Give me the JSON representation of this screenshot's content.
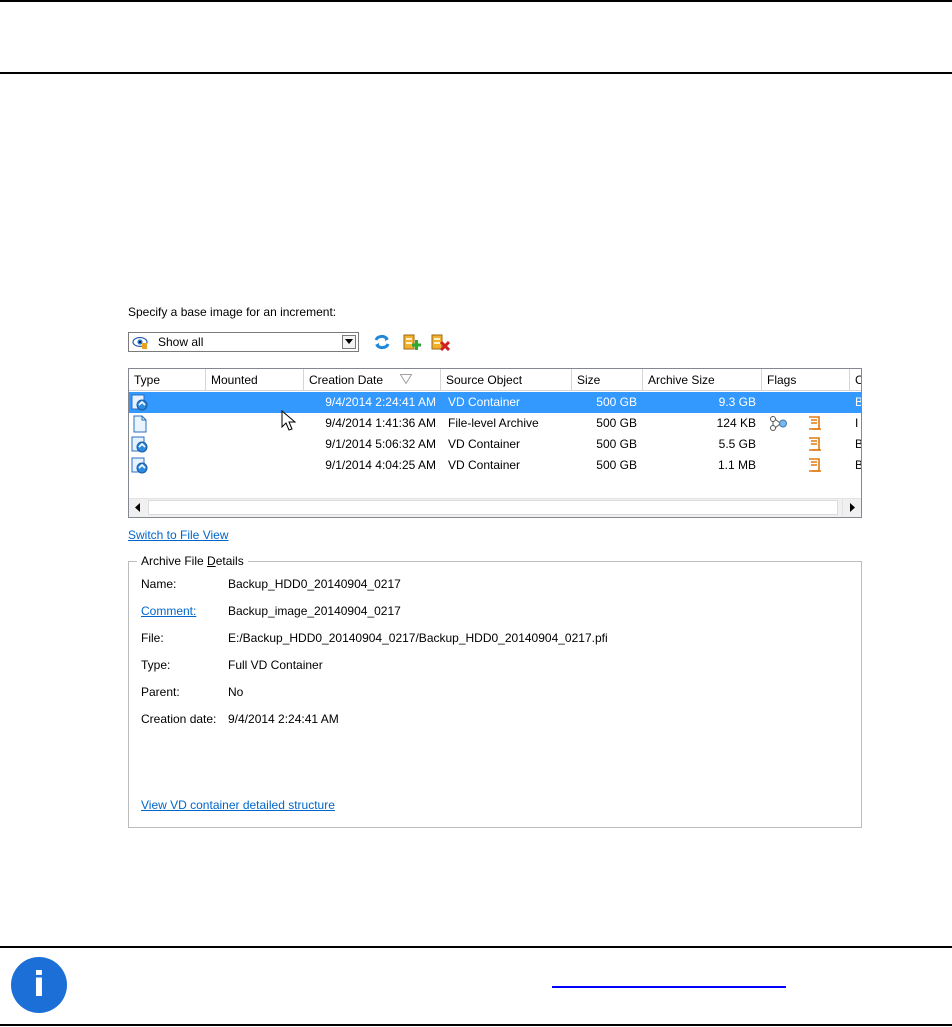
{
  "prompt": "Specify a base image for an increment:",
  "filter": {
    "selected": "Show all"
  },
  "toolbar": {
    "refresh_icon": "refresh-icon",
    "add_icon": "add-archive-icon",
    "delete_icon": "delete-archive-icon"
  },
  "list": {
    "columns": [
      "Type",
      "Mounted",
      "Creation Date",
      "Source Object",
      "Size",
      "Archive Size",
      "Flags",
      "C"
    ],
    "rows": [
      {
        "type_icon": "vd-container-icon",
        "mounted": "",
        "date": "9/4/2014 2:24:41 AM",
        "source": "VD Container",
        "size": "500 GB",
        "archive_size": "9.3 GB",
        "flags": [],
        "c": "B",
        "selected": true
      },
      {
        "type_icon": "file-archive-icon",
        "mounted": "",
        "date": "9/4/2014 1:41:36 AM",
        "source": "File-level Archive",
        "size": "500 GB",
        "archive_size": "124 KB",
        "flags": [
          "network-icon",
          "scroll-icon"
        ],
        "c": "I",
        "selected": false
      },
      {
        "type_icon": "vd-container-icon",
        "mounted": "",
        "date": "9/1/2014 5:06:32 AM",
        "source": "VD Container",
        "size": "500 GB",
        "archive_size": "5.5 GB",
        "flags": [
          "scroll-icon"
        ],
        "c": "B",
        "selected": false
      },
      {
        "type_icon": "vd-container-icon",
        "mounted": "",
        "date": "9/1/2014 4:04:25 AM",
        "source": "VD Container",
        "size": "500 GB",
        "archive_size": "1.1 MB",
        "flags": [
          "scroll-icon"
        ],
        "c": "B",
        "selected": false
      }
    ]
  },
  "switch_view_link": "Switch to File View",
  "details": {
    "title_pre": "Archive File ",
    "title_accel": "D",
    "title_post": "etails",
    "name_label": "Name:",
    "name_value": "Backup_HDD0_20140904_0217",
    "comment_label": "Comment:",
    "comment_value": "Backup_image_20140904_0217",
    "file_label": "File:",
    "file_value": "E:/Backup_HDD0_20140904_0217/Backup_HDD0_20140904_0217.pfi",
    "type_label": "Type:",
    "type_value": "Full VD Container",
    "parent_label": "Parent:",
    "parent_value": "No",
    "date_label": "Creation date:",
    "date_value": "9/4/2014 2:24:41 AM",
    "structure_link": "View VD container detailed structure"
  },
  "info_icon": "info-icon",
  "colors": {
    "selection": "#3399ff",
    "link": "#0066cc",
    "info": "#1c6fd6"
  }
}
